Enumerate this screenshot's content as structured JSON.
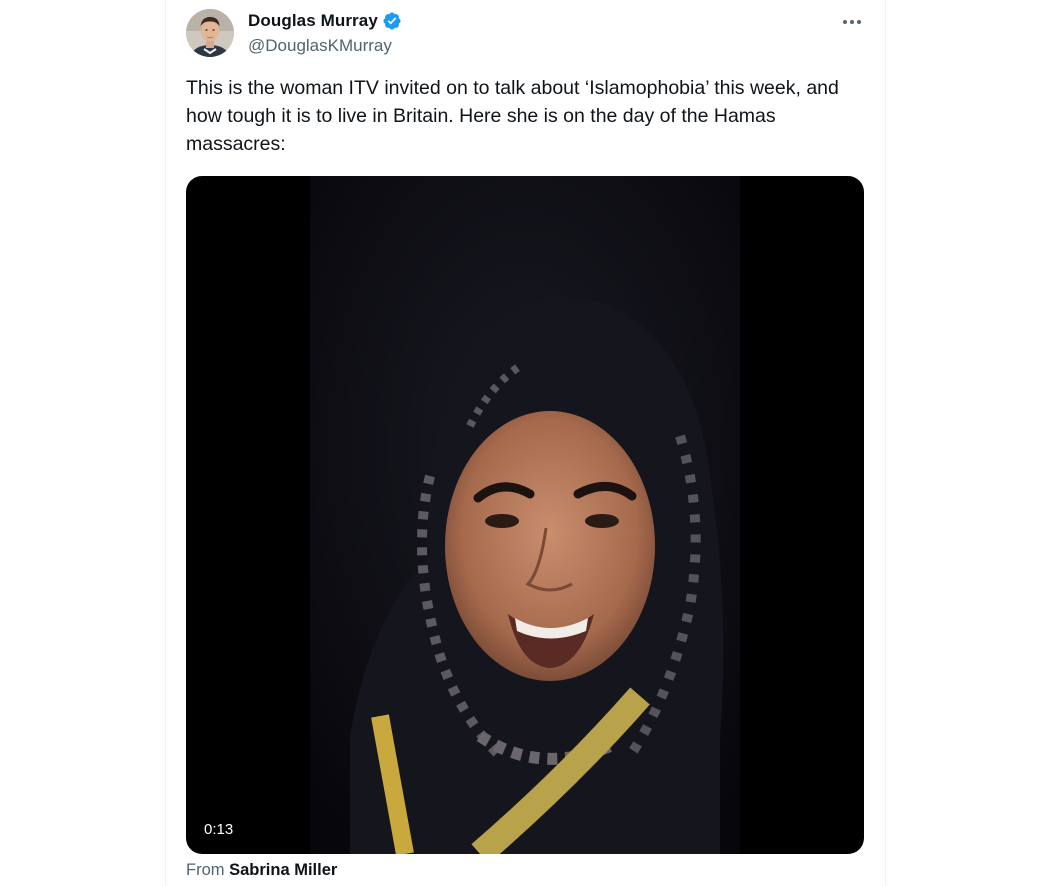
{
  "author": {
    "display_name": "Douglas Murray",
    "handle": "@DouglasKMurray",
    "verified": true
  },
  "tweet": {
    "text": "This is the woman ITV invited on to talk about ‘Islamophobia’ this week, and how tough it is to live in Britain. Here she is on the day of the Hamas massacres:"
  },
  "media": {
    "duration": "0:13"
  },
  "attribution": {
    "prefix": "From",
    "source_name": "Sabrina Miller"
  },
  "icons": {
    "verified": "verified-badge-icon",
    "more": "more-options-icon"
  },
  "colors": {
    "verified_blue": "#1d9bf0",
    "secondary_text": "#536471",
    "primary_text": "#0f1419"
  }
}
